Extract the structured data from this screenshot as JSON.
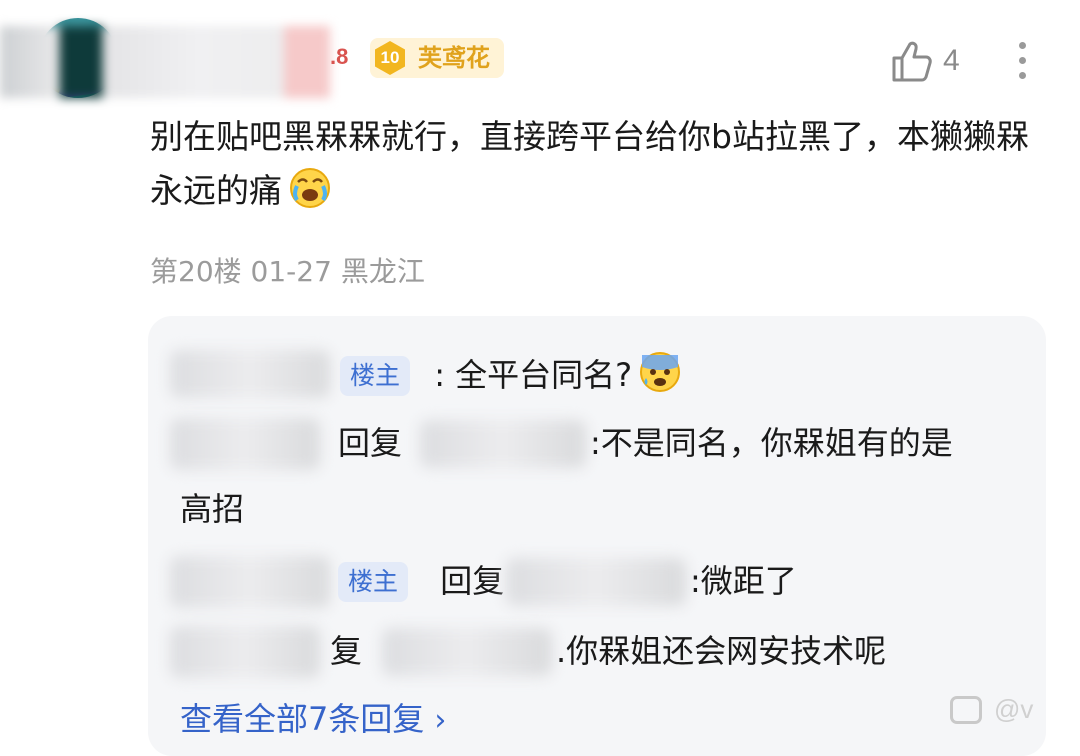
{
  "comment": {
    "user_level_fragment": ".8",
    "badge": {
      "level": "10",
      "title": "芙鸢花"
    },
    "likes": "4",
    "text": "别在贴吧黑槑槑就行，直接跨平台给你b站拉黑了，本獭獭槑永远的痛",
    "emoji": "crying-face",
    "floor": "第20楼",
    "date": "01-27",
    "location": "黑龙江"
  },
  "replies": [
    {
      "tag": "楼主",
      "text": ": 全平台同名?",
      "emoji": "anxious-sweat-face"
    },
    {
      "reply_word": "回复",
      "text": ":不是同名，你槑姐有的是",
      "text_cont": "高招"
    },
    {
      "tag": "楼主",
      "reply_word": "回复",
      "text": ":微距了"
    },
    {
      "reply_word": "复",
      "text": ".你槑姐还会网安技术呢"
    }
  ],
  "view_all": "查看全部7条回复",
  "watermark": "@v"
}
